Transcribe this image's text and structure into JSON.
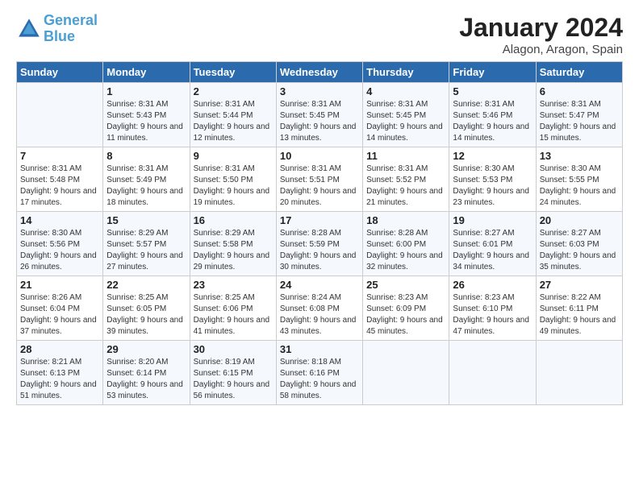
{
  "logo": {
    "line1": "General",
    "line2": "Blue"
  },
  "title": "January 2024",
  "subtitle": "Alagon, Aragon, Spain",
  "headers": [
    "Sunday",
    "Monday",
    "Tuesday",
    "Wednesday",
    "Thursday",
    "Friday",
    "Saturday"
  ],
  "weeks": [
    [
      {
        "day": "",
        "sunrise": "",
        "sunset": "",
        "daylight": ""
      },
      {
        "day": "1",
        "sunrise": "Sunrise: 8:31 AM",
        "sunset": "Sunset: 5:43 PM",
        "daylight": "Daylight: 9 hours and 11 minutes."
      },
      {
        "day": "2",
        "sunrise": "Sunrise: 8:31 AM",
        "sunset": "Sunset: 5:44 PM",
        "daylight": "Daylight: 9 hours and 12 minutes."
      },
      {
        "day": "3",
        "sunrise": "Sunrise: 8:31 AM",
        "sunset": "Sunset: 5:45 PM",
        "daylight": "Daylight: 9 hours and 13 minutes."
      },
      {
        "day": "4",
        "sunrise": "Sunrise: 8:31 AM",
        "sunset": "Sunset: 5:45 PM",
        "daylight": "Daylight: 9 hours and 14 minutes."
      },
      {
        "day": "5",
        "sunrise": "Sunrise: 8:31 AM",
        "sunset": "Sunset: 5:46 PM",
        "daylight": "Daylight: 9 hours and 14 minutes."
      },
      {
        "day": "6",
        "sunrise": "Sunrise: 8:31 AM",
        "sunset": "Sunset: 5:47 PM",
        "daylight": "Daylight: 9 hours and 15 minutes."
      }
    ],
    [
      {
        "day": "7",
        "sunrise": "Sunrise: 8:31 AM",
        "sunset": "Sunset: 5:48 PM",
        "daylight": "Daylight: 9 hours and 17 minutes."
      },
      {
        "day": "8",
        "sunrise": "Sunrise: 8:31 AM",
        "sunset": "Sunset: 5:49 PM",
        "daylight": "Daylight: 9 hours and 18 minutes."
      },
      {
        "day": "9",
        "sunrise": "Sunrise: 8:31 AM",
        "sunset": "Sunset: 5:50 PM",
        "daylight": "Daylight: 9 hours and 19 minutes."
      },
      {
        "day": "10",
        "sunrise": "Sunrise: 8:31 AM",
        "sunset": "Sunset: 5:51 PM",
        "daylight": "Daylight: 9 hours and 20 minutes."
      },
      {
        "day": "11",
        "sunrise": "Sunrise: 8:31 AM",
        "sunset": "Sunset: 5:52 PM",
        "daylight": "Daylight: 9 hours and 21 minutes."
      },
      {
        "day": "12",
        "sunrise": "Sunrise: 8:30 AM",
        "sunset": "Sunset: 5:53 PM",
        "daylight": "Daylight: 9 hours and 23 minutes."
      },
      {
        "day": "13",
        "sunrise": "Sunrise: 8:30 AM",
        "sunset": "Sunset: 5:55 PM",
        "daylight": "Daylight: 9 hours and 24 minutes."
      }
    ],
    [
      {
        "day": "14",
        "sunrise": "Sunrise: 8:30 AM",
        "sunset": "Sunset: 5:56 PM",
        "daylight": "Daylight: 9 hours and 26 minutes."
      },
      {
        "day": "15",
        "sunrise": "Sunrise: 8:29 AM",
        "sunset": "Sunset: 5:57 PM",
        "daylight": "Daylight: 9 hours and 27 minutes."
      },
      {
        "day": "16",
        "sunrise": "Sunrise: 8:29 AM",
        "sunset": "Sunset: 5:58 PM",
        "daylight": "Daylight: 9 hours and 29 minutes."
      },
      {
        "day": "17",
        "sunrise": "Sunrise: 8:28 AM",
        "sunset": "Sunset: 5:59 PM",
        "daylight": "Daylight: 9 hours and 30 minutes."
      },
      {
        "day": "18",
        "sunrise": "Sunrise: 8:28 AM",
        "sunset": "Sunset: 6:00 PM",
        "daylight": "Daylight: 9 hours and 32 minutes."
      },
      {
        "day": "19",
        "sunrise": "Sunrise: 8:27 AM",
        "sunset": "Sunset: 6:01 PM",
        "daylight": "Daylight: 9 hours and 34 minutes."
      },
      {
        "day": "20",
        "sunrise": "Sunrise: 8:27 AM",
        "sunset": "Sunset: 6:03 PM",
        "daylight": "Daylight: 9 hours and 35 minutes."
      }
    ],
    [
      {
        "day": "21",
        "sunrise": "Sunrise: 8:26 AM",
        "sunset": "Sunset: 6:04 PM",
        "daylight": "Daylight: 9 hours and 37 minutes."
      },
      {
        "day": "22",
        "sunrise": "Sunrise: 8:25 AM",
        "sunset": "Sunset: 6:05 PM",
        "daylight": "Daylight: 9 hours and 39 minutes."
      },
      {
        "day": "23",
        "sunrise": "Sunrise: 8:25 AM",
        "sunset": "Sunset: 6:06 PM",
        "daylight": "Daylight: 9 hours and 41 minutes."
      },
      {
        "day": "24",
        "sunrise": "Sunrise: 8:24 AM",
        "sunset": "Sunset: 6:08 PM",
        "daylight": "Daylight: 9 hours and 43 minutes."
      },
      {
        "day": "25",
        "sunrise": "Sunrise: 8:23 AM",
        "sunset": "Sunset: 6:09 PM",
        "daylight": "Daylight: 9 hours and 45 minutes."
      },
      {
        "day": "26",
        "sunrise": "Sunrise: 8:23 AM",
        "sunset": "Sunset: 6:10 PM",
        "daylight": "Daylight: 9 hours and 47 minutes."
      },
      {
        "day": "27",
        "sunrise": "Sunrise: 8:22 AM",
        "sunset": "Sunset: 6:11 PM",
        "daylight": "Daylight: 9 hours and 49 minutes."
      }
    ],
    [
      {
        "day": "28",
        "sunrise": "Sunrise: 8:21 AM",
        "sunset": "Sunset: 6:13 PM",
        "daylight": "Daylight: 9 hours and 51 minutes."
      },
      {
        "day": "29",
        "sunrise": "Sunrise: 8:20 AM",
        "sunset": "Sunset: 6:14 PM",
        "daylight": "Daylight: 9 hours and 53 minutes."
      },
      {
        "day": "30",
        "sunrise": "Sunrise: 8:19 AM",
        "sunset": "Sunset: 6:15 PM",
        "daylight": "Daylight: 9 hours and 56 minutes."
      },
      {
        "day": "31",
        "sunrise": "Sunrise: 8:18 AM",
        "sunset": "Sunset: 6:16 PM",
        "daylight": "Daylight: 9 hours and 58 minutes."
      },
      {
        "day": "",
        "sunrise": "",
        "sunset": "",
        "daylight": ""
      },
      {
        "day": "",
        "sunrise": "",
        "sunset": "",
        "daylight": ""
      },
      {
        "day": "",
        "sunrise": "",
        "sunset": "",
        "daylight": ""
      }
    ]
  ]
}
